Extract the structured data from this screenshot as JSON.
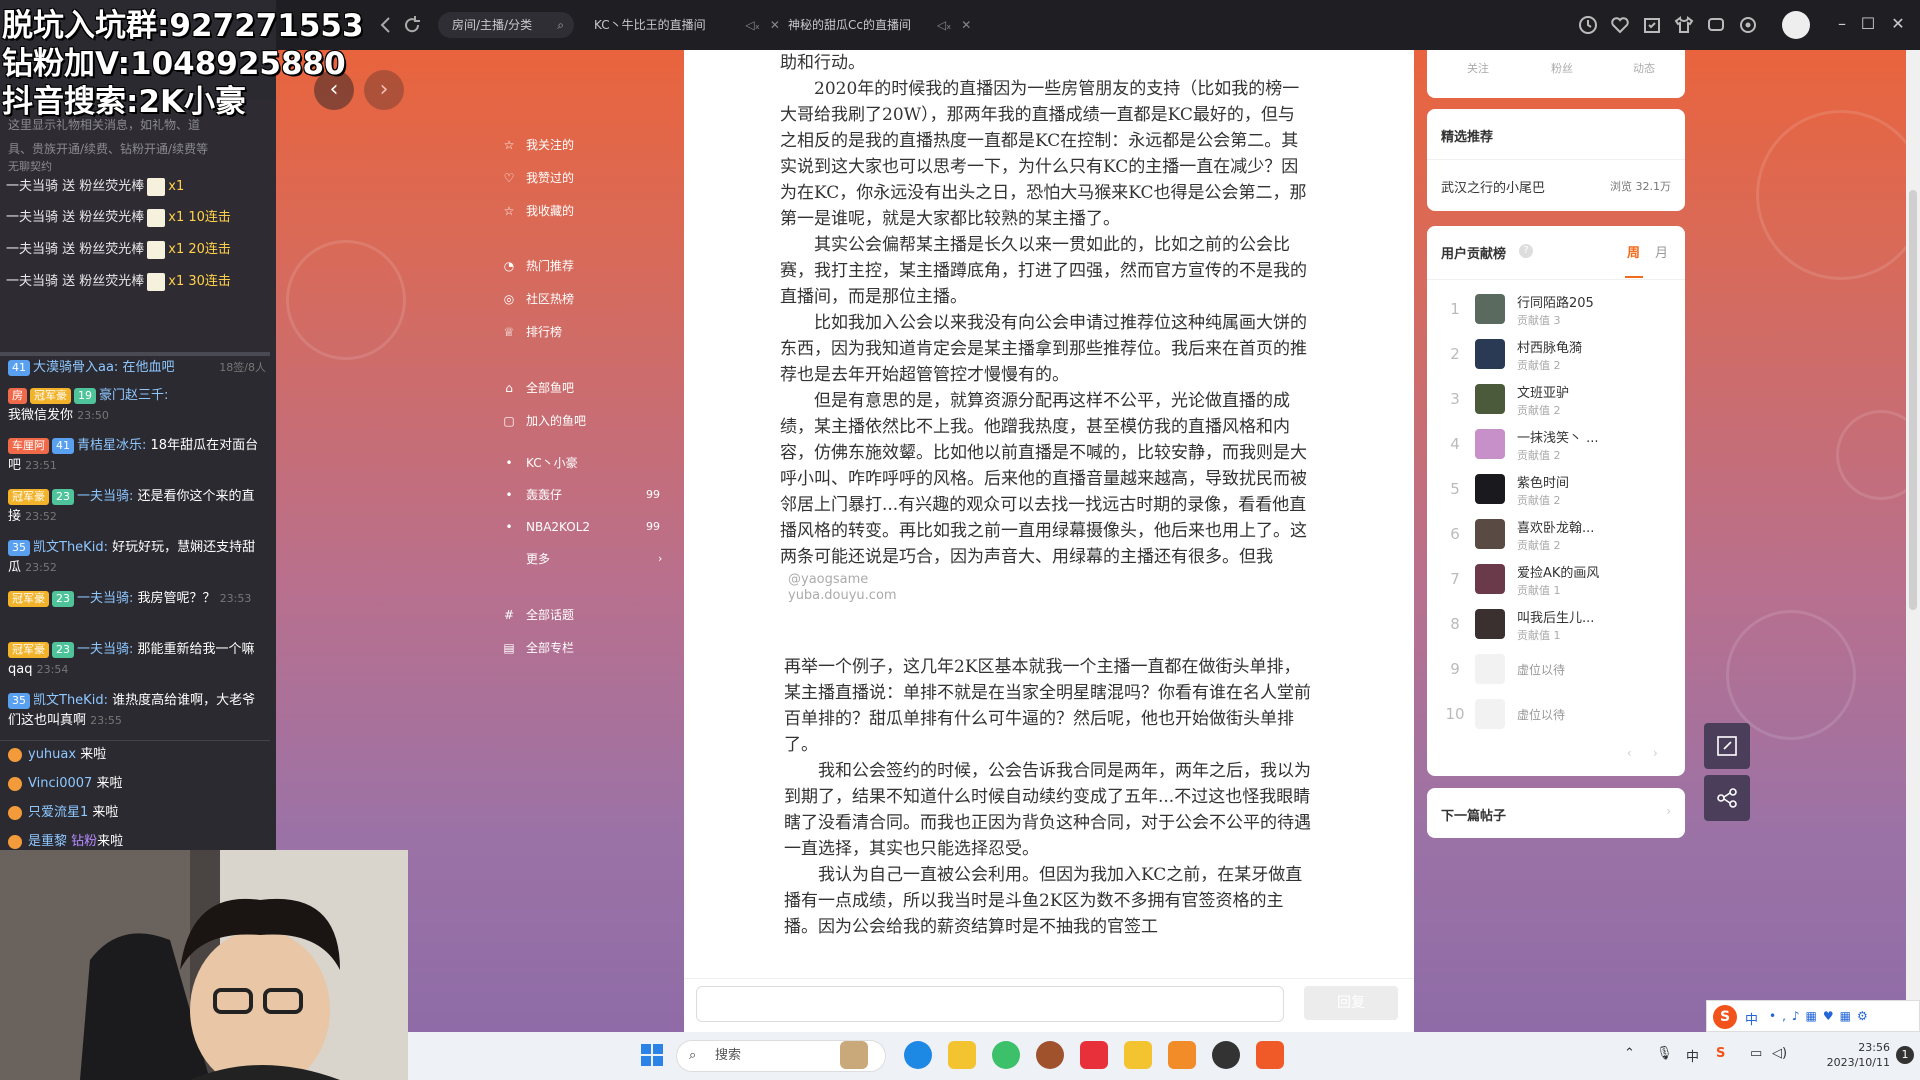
{
  "overlay": {
    "line1": "脱坑入坑群:927271553",
    "line2": "钻粉加V:1048925880",
    "line3": "抖音搜索:2K小豪"
  },
  "browser": {
    "tabs": [
      {
        "label": "房间/主播/分类"
      },
      {
        "label": "KC丶牛比王的直播间"
      },
      {
        "label": "神秘的甜瓜Cc的直播间"
      }
    ]
  },
  "chat_panel": {
    "notice_lines": [
      "这里显示礼物相关消息，如礼物、道",
      "具、贵族开通/续费、钻粉开通/续费等",
      "无聊契约"
    ],
    "gifts": [
      {
        "text": "一夫当骑 送 粉丝荧光棒",
        "count": "x1",
        "combo": ""
      },
      {
        "text": "一夫当骑 送 粉丝荧光棒",
        "count": "x1",
        "combo": "10连击"
      },
      {
        "text": "一夫当骑 送 粉丝荧光棒",
        "count": "x1",
        "combo": "20连击"
      },
      {
        "text": "一夫当骑 送 粉丝荧光棒",
        "count": "x1",
        "combo": "30连击"
      }
    ],
    "scroll_row": {
      "text": "大漠骑骨入aa: 在他血吧",
      "meta": "18签/8人"
    },
    "messages": [
      {
        "badges": [
          "冠军豪",
          "19"
        ],
        "name": "豪门赵三千:",
        "text": "我微信发你",
        "time": "23:50"
      },
      {
        "badges": [
          "车厘阿",
          "41"
        ],
        "name": "青桔星冰乐:",
        "text": "18年甜瓜在对面台吧",
        "time": "23:51"
      },
      {
        "badges": [
          "冠军豪",
          "23"
        ],
        "name": "一夫当骑:",
        "text": "还是看你这个来的直接",
        "time": "23:52"
      },
      {
        "badges": [
          "35"
        ],
        "name": "凯文TheKid:",
        "text": "好玩好玩，慧娴还支持甜瓜",
        "time": "23:52"
      },
      {
        "badges": [
          "冠军豪",
          "23"
        ],
        "name": "一夫当骑:",
        "text": "我房管呢？？",
        "time": "23:53"
      },
      {
        "badges": [
          "冠军豪",
          "23"
        ],
        "name": "一夫当骑:",
        "text": "那能重新给我一个嘛qaq",
        "time": "23:54"
      },
      {
        "badges": [
          "35"
        ],
        "name": "凯文TheKid:",
        "text": "谁热度高给谁啊，大老爷们这也叫真啊",
        "time": "23:55"
      }
    ],
    "entries": [
      {
        "name": "yuhuax",
        "text": "来啦"
      },
      {
        "name": "Vinci0007",
        "text": "来啦"
      },
      {
        "name": "只爱流星1",
        "text": "来啦"
      },
      {
        "name": "是重黎",
        "extra": "钻粉",
        "text": "来啦"
      }
    ]
  },
  "nav": {
    "items": [
      {
        "icon": "☆",
        "label": "我关注的"
      },
      {
        "icon": "♡",
        "label": "我赞过的"
      },
      {
        "icon": "☆",
        "label": "我收藏的"
      },
      {
        "icon": "◔",
        "label": "热门推荐"
      },
      {
        "icon": "◎",
        "label": "社区热榜"
      },
      {
        "icon": "♕",
        "label": "排行榜"
      },
      {
        "icon": "⌂",
        "label": "全部鱼吧"
      },
      {
        "icon": "▢",
        "label": "加入的鱼吧"
      }
    ],
    "bars": [
      {
        "label": "KC丶小豪",
        "count": ""
      },
      {
        "label": "轰轰仔",
        "count": "99"
      },
      {
        "label": "NBA2KOL2",
        "count": "99"
      },
      {
        "label": "更多",
        "count": "›"
      }
    ],
    "bottom": [
      {
        "icon": "#",
        "label": "全部话题"
      },
      {
        "icon": "▤",
        "label": "全部专栏"
      }
    ]
  },
  "article": {
    "paragraphs_top": [
      "助和行动。",
      "　　2020年的时候我的直播因为一些房管朋友的支持（比如我的榜一大哥给我刷了20W），那两年我的直播成绩一直都是KC最好的，但与之相反的是我的直播热度一直都是KC在控制：永远都是公会第二。其实说到这大家也可以思考一下，为什么只有KC的主播一直在减少？因为在KC，你永远没有出头之日，恐怕大马猴来KC也得是公会第二，那第一是谁呢，就是大家都比较熟的某主播了。",
      "　　其实公会偏帮某主播是长久以来一贯如此的，比如之前的公会比赛，我打主控，某主播蹲底角，打进了四强，然而官方宣传的不是我的直播间，而是那位主播。",
      "　　比如我加入公会以来我没有向公会申请过推荐位这种纯属画大饼的东西，因为我知道肯定会是某主播拿到那些推荐位。我后来在首页的推荐也是去年开始超管管控才慢慢有的。",
      "　　但是有意思的是，就算资源分配再这样不公平，光论做直播的成绩，某主播依然比不上我。他蹭我热度，甚至模仿我的直播风格和内容，仿佛东施效颦。比如他以前直播是不喊的，比较安静，而我则是大呼小叫、咋咋呼呼的风格。后来他的直播音量越来越高，导致扰民而被邻居上门暴打...有兴趣的观众可以去找一找远古时期的录像，看看他直播风格的转变。再比如我之前一直用绿幕摄像头，他后来也用上了。这两条可能还说是巧合，因为声音大、用绿幕的主播还有很多。但我"
    ],
    "watermark": "@yaogsame\nyuba.douyu.com",
    "paragraphs_bottom": [
      "再举一个例子，这几年2K区基本就我一个主播一直都在做街头单排，某主播直播说：单排不就是在当家全明星瞎混吗？你看有谁在名人堂前百单排的？甜瓜单排有什么可牛逼的？然后呢，他也开始做街头单排了。",
      "　　我和公会签约的时候，公会告诉我合同是两年，两年之后，我以为到期了，结果不知道什么时候自动续约变成了五年...不过这也怪我眼睛瞎了没看清合同。而我也正因为背负这种合同，对于公会不公平的待遇一直选择，其实也只能选择忍受。",
      "　　我认为自己一直被公会利用。但因为我加入KC之前，在某牙做直播有一点成绩，所以我当时是斗鱼2K区为数不多拥有官签资格的主播。因为公会给我的薪资结算时是不抽我的官签工"
    ],
    "reply_label": "回复"
  },
  "profile_stats": {
    "labels": [
      "关注",
      "粉丝",
      "动态"
    ]
  },
  "featured": {
    "title": "精选推荐",
    "item": "武汉之行的小尾巴",
    "views": "浏览 32.1万"
  },
  "contrib": {
    "title": "用户贡献榜",
    "tab_week": "周",
    "tab_month": "月",
    "rows": [
      {
        "rank": "1",
        "name": "行同陌路205",
        "value": "贡献值 3"
      },
      {
        "rank": "2",
        "name": "村西脉龟漪",
        "value": "贡献值 2"
      },
      {
        "rank": "3",
        "name": "文班亚驴",
        "value": "贡献值 2"
      },
      {
        "rank": "4",
        "name": "一抹浅笑丶 ...",
        "value": "贡献值 2"
      },
      {
        "rank": "5",
        "name": "紫色时间",
        "value": "贡献值 2"
      },
      {
        "rank": "6",
        "name": "喜欢卧龙翰...",
        "value": "贡献值 2"
      },
      {
        "rank": "7",
        "name": "爱捡AK的画风",
        "value": "贡献值 1"
      },
      {
        "rank": "8",
        "name": "叫我后生儿...",
        "value": "贡献值 1"
      },
      {
        "rank": "9",
        "name": "虚位以待",
        "value": ""
      },
      {
        "rank": "10",
        "name": "虚位以待",
        "value": ""
      }
    ]
  },
  "next_post": {
    "label": "下一篇帖子"
  },
  "taskbar": {
    "search_label": "搜索",
    "time": "23:56",
    "date": "2023/10/11",
    "ime_label": "中"
  }
}
